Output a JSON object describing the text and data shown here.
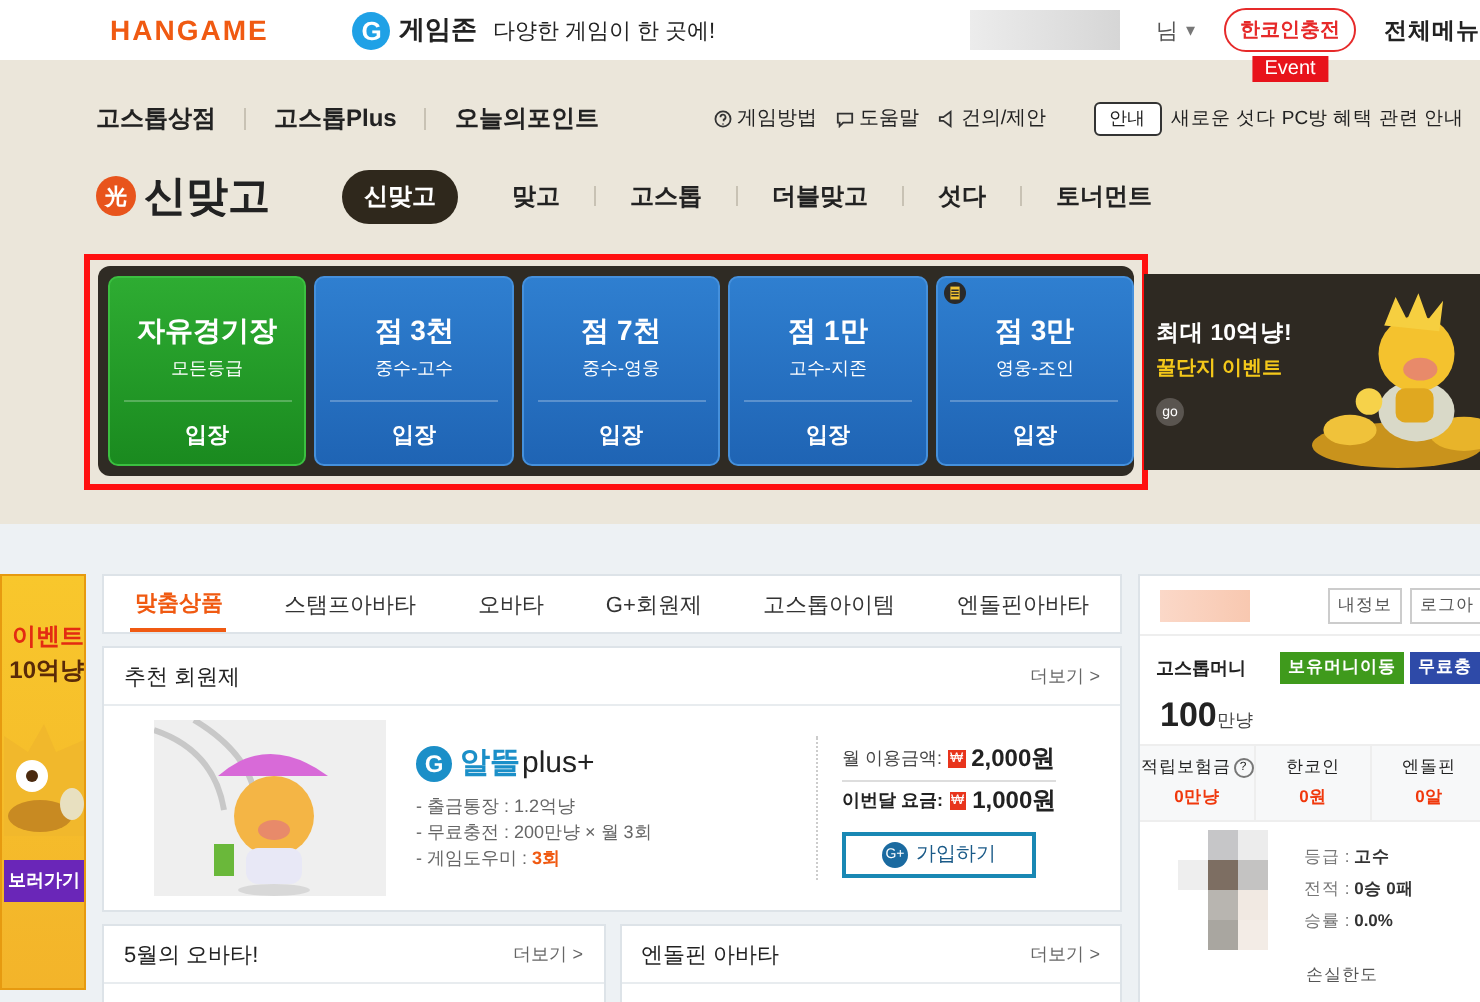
{
  "topbar": {
    "logo": "HANGAME",
    "zone_badge": "G",
    "zone": "게임존",
    "tagline": "다양한 게임이 한 곳에!",
    "user_suffix": "님",
    "dropdown": "▾",
    "charge_button": "한코인충전",
    "event_tag": "Event",
    "all_menu": "전체메뉴"
  },
  "shop_links": [
    "고스톱상점",
    "고스톱Plus",
    "오늘의포인트"
  ],
  "help_links": [
    {
      "kind": "question",
      "label": "게임방법"
    },
    {
      "kind": "chat",
      "label": "도움말"
    },
    {
      "kind": "speaker",
      "label": "건의/제안"
    }
  ],
  "notice": {
    "badge": "안내",
    "text": "새로운 섯다 PC방 혜택 관련 안내"
  },
  "game": {
    "emblem": "光",
    "title": "신맞고"
  },
  "game_tabs": [
    {
      "label": "신맞고",
      "selected": true
    },
    {
      "label": "맞고",
      "selected": false
    },
    {
      "label": "고스톱",
      "selected": false
    },
    {
      "label": "더블맞고",
      "selected": false
    },
    {
      "label": "섯다",
      "selected": false
    },
    {
      "label": "토너먼트",
      "selected": false
    }
  ],
  "rooms": [
    {
      "kind": "free",
      "title": "자유경기장",
      "grade": "모든등급",
      "enter": "입장",
      "marked": false
    },
    {
      "kind": "rank",
      "title": "점 3천",
      "grade": "중수-고수",
      "enter": "입장",
      "marked": false
    },
    {
      "kind": "rank",
      "title": "점 7천",
      "grade": "중수-영웅",
      "enter": "입장",
      "marked": false
    },
    {
      "kind": "rank",
      "title": "점 1만",
      "grade": "고수-지존",
      "enter": "입장",
      "marked": false
    },
    {
      "kind": "rank",
      "title": "점 3만",
      "grade": "영웅-조인",
      "enter": "입장",
      "marked": true
    }
  ],
  "promo": {
    "title": "최대 10억냥!",
    "subtitle": "꿀단지 이벤트",
    "go": "go"
  },
  "side_banner": {
    "line1": "이벤트",
    "line2": "10억냥",
    "button": "보러가기"
  },
  "product_tabs": [
    {
      "label": "맞춤상품",
      "selected": true
    },
    {
      "label": "스탬프아바타",
      "selected": false
    },
    {
      "label": "오바타",
      "selected": false
    },
    {
      "label": "G+회원제",
      "selected": false
    },
    {
      "label": "고스톱아이템",
      "selected": false
    },
    {
      "label": "엔돌핀아바타",
      "selected": false
    }
  ],
  "membership": {
    "heading": "추천 회원제",
    "more": "더보기 >",
    "brand_badge": "G",
    "brand": "알뜰",
    "brand_suffix": "plus+",
    "features": [
      "- 출금통장 : 1.2억냥",
      "- 무료충전 : 200만냥 × 월 3회",
      "- 게임도우미 : **3회**"
    ],
    "prices": [
      {
        "label": "월 이용금액:",
        "currency": "₩",
        "amount": "2,000원"
      },
      {
        "label": "이번달 요금:",
        "currency": "₩",
        "amount": "1,000원"
      }
    ],
    "join_badge": "G+",
    "join": "가입하기"
  },
  "bottom_cards": [
    {
      "heading": "5월의 오바타!",
      "more": "더보기 >"
    },
    {
      "heading": "엔돌핀 아바타",
      "more": "더보기 >"
    }
  ],
  "user_panel": {
    "buttons": [
      "내정보",
      "로그아"
    ],
    "money_label": "고스톱머니",
    "actions": [
      {
        "label": "보유머니이동",
        "color": "#3f9a1c"
      },
      {
        "label": "무료충",
        "color": "#2e4aa8"
      }
    ],
    "money": "100",
    "money_unit": "만냥",
    "stats": [
      {
        "label": "적립보험금",
        "help": "?",
        "value": "0만냥"
      },
      {
        "label": "한코인",
        "value": "0원"
      },
      {
        "label": "엔돌핀",
        "value": "0알"
      }
    ],
    "record": [
      {
        "label": "등급 : ",
        "value": "고수"
      },
      {
        "label": "전적 : ",
        "value": "0승 0패"
      },
      {
        "label": "승률 : ",
        "value": "0.0%"
      }
    ],
    "limit": "손실한도"
  }
}
